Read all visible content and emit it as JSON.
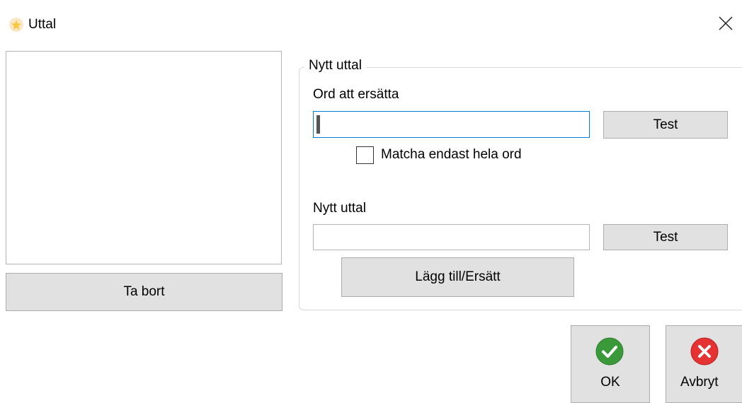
{
  "window": {
    "title": "Uttal",
    "close_icon": "close-icon",
    "app_icon": "app-star-icon"
  },
  "left_panel": {
    "list_items": [],
    "remove_button_label": "Ta bort"
  },
  "group": {
    "legend": "Nytt uttal",
    "word_label": "Ord att ersätta",
    "word_value": "",
    "test_label_1": "Test",
    "checkbox_label": "Matcha endast hela ord",
    "checkbox_checked": false,
    "pron_label": "Nytt uttal",
    "pron_value": "",
    "test_label_2": "Test",
    "add_replace_label": "Lägg till/Ersätt"
  },
  "footer": {
    "ok_label": "OK",
    "ok_icon": "check-icon",
    "cancel_label": "Avbryt",
    "cancel_icon": "cancel-x-icon"
  },
  "colors": {
    "ok_green": "#3a9a3a",
    "cancel_red": "#e53333",
    "focus_blue": "#0078d7",
    "button_gray": "#e1e1e1"
  }
}
